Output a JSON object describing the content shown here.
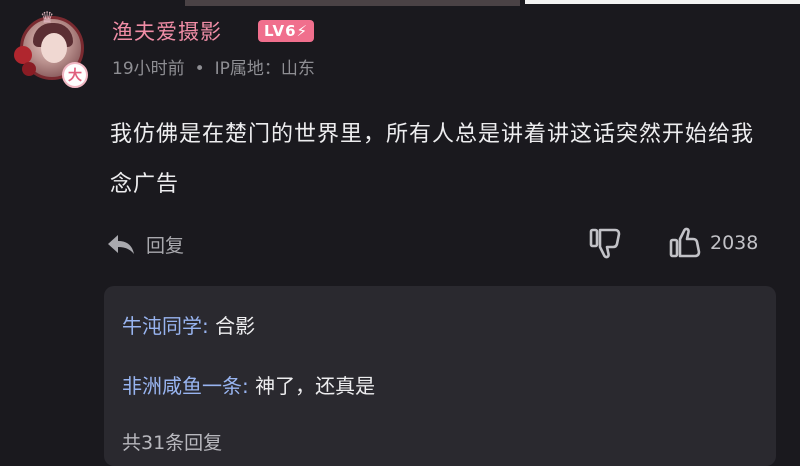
{
  "comment": {
    "avatar_badge": "大",
    "username": "渔夫爱摄影",
    "level": "LV6⚡",
    "time": "19小时前",
    "separator": "•",
    "ip_location": "IP属地：山东",
    "text": "我仿佛是在楚门的世界里，所有人总是讲着讲这话突然开始给我念广告",
    "reply_label": "回复",
    "like_count": "2038"
  },
  "replies": {
    "items": [
      {
        "author": "牛沌同学:",
        "text": " 合影"
      },
      {
        "author": "非洲咸鱼一条:",
        "text": " 神了，还真是"
      }
    ],
    "total_label": "共31条回复"
  },
  "colors": {
    "background": "#1a191e",
    "username": "#f08da6",
    "level_badge": "#f06f8d",
    "reply_author": "#98b4f0",
    "replies_box": "#2a292f"
  }
}
